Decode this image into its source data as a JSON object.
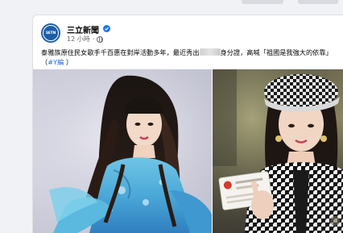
{
  "post": {
    "page_name": "三立新聞",
    "avatar_logo_text": "SETN",
    "timestamp": "12 小時",
    "audience_icon": "globe-icon",
    "verified_icon": "verified-badge-icon",
    "caption_part1": "泰雅族原住民女歌手千百惠在對岸活動多年，最近秀出",
    "caption_part2": "身分證，高喊「祖國是我強大的依靠」",
    "caption_open_paren": "（",
    "hashtag": "#Y編",
    "caption_close_paren": "）"
  },
  "colors": {
    "brand_blue": "#1d5ea8",
    "link_blue": "#216fdb",
    "verified_blue": "#1877f2"
  }
}
